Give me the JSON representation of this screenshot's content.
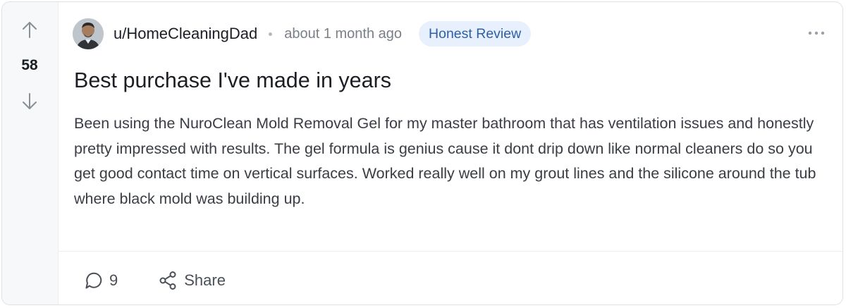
{
  "post": {
    "votes": {
      "count": "58",
      "upvote_icon": "arrow-up-icon",
      "downvote_icon": "arrow-down-icon"
    },
    "author": {
      "username": "u/HomeCleaningDad",
      "avatar_icon": "avatar"
    },
    "timestamp": "about 1 month ago",
    "flair": "Honest Review",
    "title": "Best purchase I've made in years",
    "body": "Been using the NuroClean Mold Removal Gel for my master bathroom that has ventilation issues and honestly pretty impressed with results. The gel formula is genius cause it dont drip down like normal cleaners do so you get good contact time on vertical surfaces. Worked really well on my grout lines and the silicone around the tub where black mold was building up.",
    "actions": {
      "comments_count": "9",
      "share_label": "Share"
    }
  },
  "colors": {
    "badge_bg": "#e7f0fc",
    "badge_text": "#2f5fa8",
    "vote_rail_bg": "#f7f8f9",
    "border": "#dfe1e5"
  }
}
